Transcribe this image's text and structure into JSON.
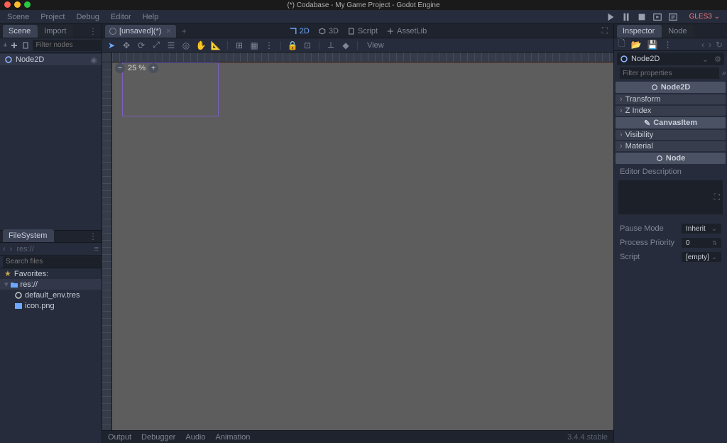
{
  "window": {
    "title": "(*) Codabase - My Game Project - Godot Engine"
  },
  "menu": {
    "items": [
      "Scene",
      "Project",
      "Debug",
      "Editor",
      "Help"
    ],
    "renderer": "GLES3"
  },
  "workspace": {
    "items": [
      "2D",
      "3D",
      "Script",
      "AssetLib"
    ],
    "active": 0
  },
  "scene_panel": {
    "tabs": [
      "Scene",
      "Import"
    ],
    "active": 0,
    "filter_placeholder": "Filter nodes",
    "root_node": "Node2D"
  },
  "scene_tabs": {
    "current": "[unsaved](*)"
  },
  "viewport": {
    "zoom_label": "25 %",
    "view_menu": "View"
  },
  "filesystem": {
    "title": "FileSystem",
    "path": "res://",
    "search_placeholder": "Search files",
    "favorites_label": "Favorites:",
    "root": "res://",
    "files": [
      "default_env.tres",
      "icon.png"
    ]
  },
  "bottom": {
    "tabs": [
      "Output",
      "Debugger",
      "Audio",
      "Animation"
    ],
    "version": "3.4.4.stable"
  },
  "inspector": {
    "tabs": [
      "Inspector",
      "Node"
    ],
    "active": 0,
    "object": "Node2D",
    "filter_placeholder": "Filter properties",
    "sections": {
      "node2d": {
        "title": "Node2D",
        "groups": [
          "Transform",
          "Z Index"
        ]
      },
      "canvasitem": {
        "title": "CanvasItem",
        "groups": [
          "Visibility",
          "Material"
        ]
      },
      "node": {
        "title": "Node"
      }
    },
    "editor_desc_label": "Editor Description",
    "props": {
      "pause_mode": {
        "label": "Pause Mode",
        "value": "Inherit"
      },
      "process_priority": {
        "label": "Process Priority",
        "value": "0"
      },
      "script": {
        "label": "Script",
        "value": "[empty]"
      }
    }
  }
}
